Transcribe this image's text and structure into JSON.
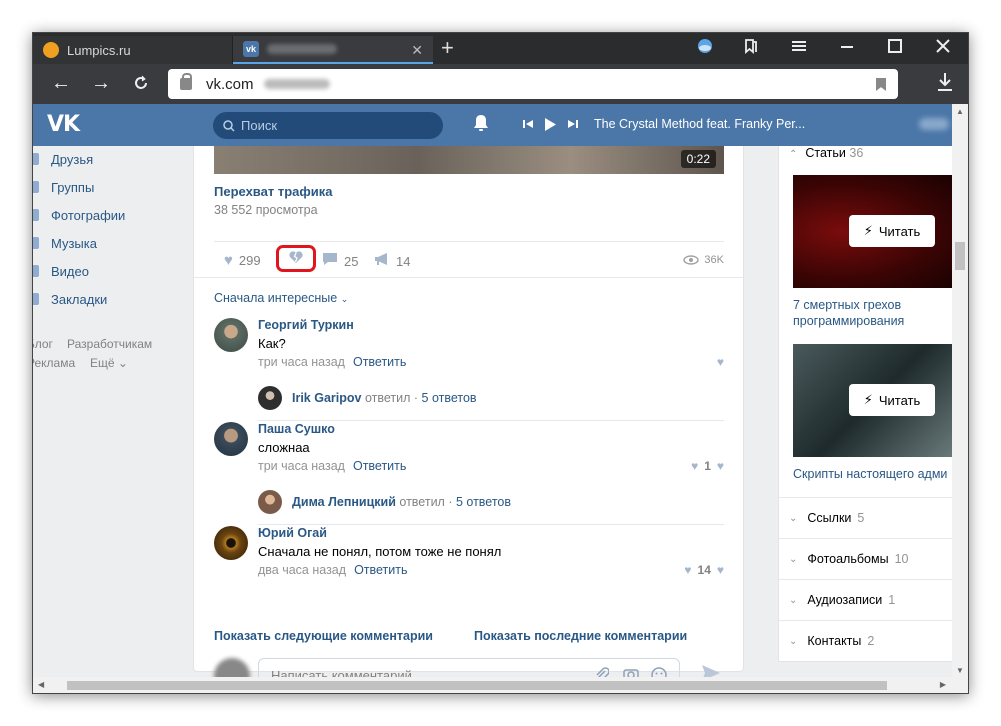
{
  "browser": {
    "tabs": [
      {
        "label": "Lumpics.ru",
        "active": false
      },
      {
        "label": "",
        "active": true
      }
    ],
    "address": "vk.com",
    "window_buttons": [
      "minimize",
      "maximize",
      "close"
    ]
  },
  "vk": {
    "logo": "VK",
    "search_placeholder": "Поиск",
    "player_track": "The Crystal Method feat. Franky Per..."
  },
  "left_nav": {
    "items": [
      "Друзья",
      "Группы",
      "Фотографии",
      "Музыка",
      "Видео",
      "Закладки"
    ],
    "footer": [
      "Блог",
      "Разработчикам",
      "Реклама",
      "Ещё"
    ]
  },
  "post": {
    "video_duration": "0:22",
    "video_title": "Перехват трафика",
    "video_views": "38 552 просмотра",
    "likes": "299",
    "comments": "25",
    "reposts": "14",
    "views": "36K"
  },
  "comments": {
    "sort": "Сначала интересные",
    "items": [
      {
        "name": "Георгий Туркин",
        "text": "Как?",
        "time": "три часа назад",
        "reply_label": "Ответить",
        "likes": "",
        "reply": {
          "name": "Irik Garipov",
          "verb": "ответил",
          "count": "5 ответов"
        }
      },
      {
        "name": "Паша Сушко",
        "text": "сложнаа",
        "time": "три часа назад",
        "reply_label": "Ответить",
        "likes": "1",
        "reply": {
          "name": "Дима Лепницкий",
          "verb": "ответил",
          "count": "5 ответов"
        }
      },
      {
        "name": "Юрий Огай",
        "text": "Сначала не понял, потом тоже не понял",
        "time": "два часа назад",
        "reply_label": "Ответить",
        "likes": "14"
      }
    ],
    "show_next": "Показать следующие комментарии",
    "show_last": "Показать последние комментарии",
    "input_placeholder": "Написать комментарий..."
  },
  "right_col": {
    "articles_label": "Статьи",
    "articles_count": "36",
    "read_label": "Читать",
    "articles": [
      {
        "title": "7 смертных грехов программирования"
      },
      {
        "title": "Скрипты настоящего адми"
      }
    ],
    "sections": [
      {
        "label": "Ссылки",
        "count": "5"
      },
      {
        "label": "Фотоальбомы",
        "count": "10"
      },
      {
        "label": "Аудиозаписи",
        "count": "1"
      },
      {
        "label": "Контакты",
        "count": "2"
      }
    ]
  }
}
